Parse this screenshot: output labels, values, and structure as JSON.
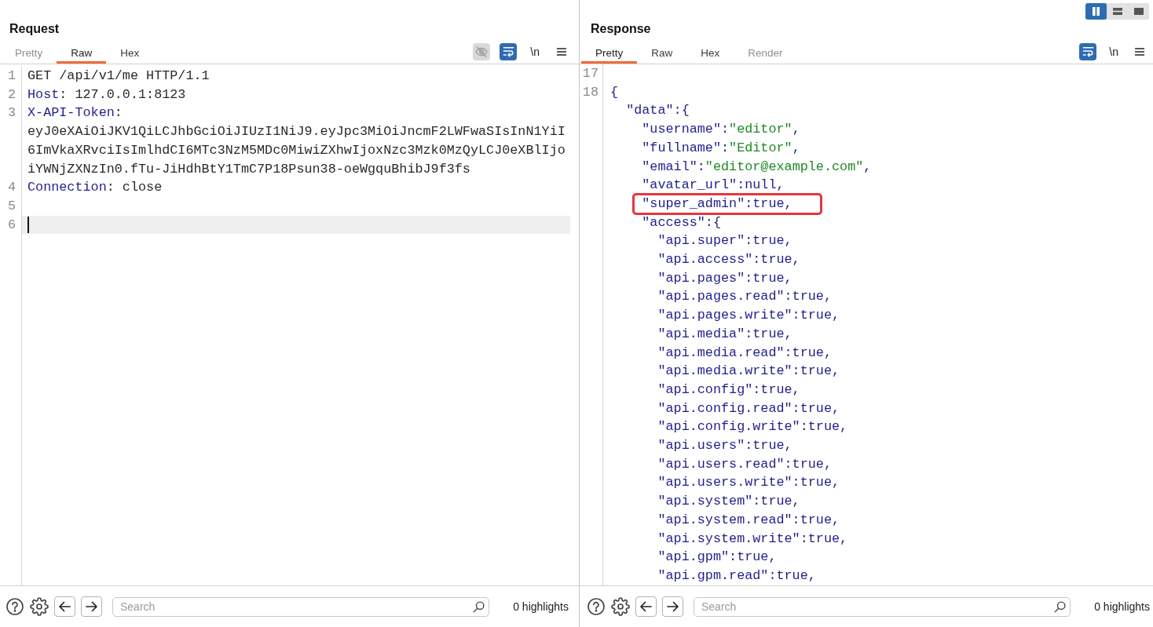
{
  "layout_buttons": [
    {
      "kind": "columns",
      "selected": true
    },
    {
      "kind": "rows",
      "selected": false
    },
    {
      "kind": "single",
      "selected": false
    }
  ],
  "request": {
    "title": "Request",
    "tabs": [
      {
        "label": "Pretty",
        "selected": false,
        "disabled": true
      },
      {
        "label": "Raw",
        "selected": true,
        "disabled": false
      },
      {
        "label": "Hex",
        "selected": false,
        "disabled": false
      }
    ],
    "toolbar": [
      {
        "kind": "eye",
        "on": false
      },
      {
        "kind": "wrap",
        "on": true
      },
      {
        "kind": "label",
        "label": "\\n"
      },
      {
        "kind": "menu"
      }
    ],
    "lines": [
      {
        "number": "1",
        "current": false,
        "tokens": [
          {
            "kind": "text",
            "text": "GET /api/v1/me HTTP/1.1"
          }
        ]
      },
      {
        "number": "2",
        "current": false,
        "tokens": [
          {
            "kind": "header",
            "text": "Host"
          },
          {
            "kind": "text",
            "text": ": 127.0.0.1:8123"
          }
        ]
      },
      {
        "number": "3",
        "current": false,
        "tokens": [
          {
            "kind": "header",
            "text": "X-API-Token"
          },
          {
            "kind": "text",
            "text": ": eyJ0eXAiOiJKV1QiLCJhbGciOiJIUzI1NiJ9.eyJpc3MiOiJncmF2LWFwaSIsInN1YiI6ImVkaXRvciIsImlhdCI6MTc3NzM5MDc0MiwiZXhwIjoxNzc3Mzk0MzQyLCJ0eXBlIjoiYWNjZXNzIn0.fTu-JiHdhBtY1TmC7P18Psun38-oeWgquBhibJ9f3fs"
          }
        ]
      },
      {
        "number": "4",
        "current": false,
        "tokens": [
          {
            "kind": "header",
            "text": "Connection"
          },
          {
            "kind": "text",
            "text": ": close"
          }
        ]
      },
      {
        "number": "5",
        "current": false
      },
      {
        "number": "6",
        "current": true
      }
    ],
    "footer": {
      "search": {
        "placeholder": "Search"
      },
      "highlights": "0 highlights"
    }
  },
  "response": {
    "title": "Response",
    "tabs": [
      {
        "label": "Pretty",
        "selected": true,
        "disabled": false
      },
      {
        "label": "Raw",
        "selected": false,
        "disabled": false
      },
      {
        "label": "Hex",
        "selected": false,
        "disabled": false
      },
      {
        "label": "Render",
        "selected": false,
        "disabled": true
      }
    ],
    "toolbar": [
      {
        "kind": "wrap",
        "on": true
      },
      {
        "kind": "label",
        "label": "\\n"
      },
      {
        "kind": "menu"
      }
    ],
    "lines": [
      {
        "number": "17"
      },
      {
        "number": "18",
        "tokens": [
          {
            "kind": "syntax",
            "text": "{"
          }
        ],
        "children": [
          {
            "tokens": [
              {
                "kind": "syntax",
                "text": "\"data\":{"
              }
            ],
            "children": [
              {
                "highlighted": false,
                "tokens": [
                  {
                    "kind": "syntax",
                    "text": "\"username\":"
                  },
                  {
                    "kind": "string",
                    "text": "\"editor\""
                  },
                  {
                    "kind": "syntax",
                    "text": ","
                  }
                ]
              },
              {
                "highlighted": false,
                "tokens": [
                  {
                    "kind": "syntax",
                    "text": "\"fullname\":"
                  },
                  {
                    "kind": "string",
                    "text": "\"Editor\""
                  },
                  {
                    "kind": "syntax",
                    "text": ","
                  }
                ]
              },
              {
                "highlighted": false,
                "tokens": [
                  {
                    "kind": "syntax",
                    "text": "\"email\":"
                  },
                  {
                    "kind": "string",
                    "text": "\"editor@example.com\""
                  },
                  {
                    "kind": "syntax",
                    "text": ","
                  }
                ]
              },
              {
                "highlighted": false,
                "tokens": [
                  {
                    "kind": "syntax",
                    "text": "\"avatar_url\":null,"
                  }
                ]
              },
              {
                "highlighted": true,
                "tokens": [
                  {
                    "kind": "syntax",
                    "text": "\"super_admin\":true,"
                  }
                ]
              },
              {
                "highlighted": false,
                "tokens": [
                  {
                    "kind": "syntax",
                    "text": "\"access\":{"
                  }
                ],
                "children": [
                  {
                    "tokens": [
                      {
                        "kind": "syntax",
                        "text": "\"api.super\":true,"
                      }
                    ]
                  },
                  {
                    "tokens": [
                      {
                        "kind": "syntax",
                        "text": "\"api.access\":true,"
                      }
                    ]
                  },
                  {
                    "tokens": [
                      {
                        "kind": "syntax",
                        "text": "\"api.pages\":true,"
                      }
                    ]
                  },
                  {
                    "tokens": [
                      {
                        "kind": "syntax",
                        "text": "\"api.pages.read\":true,"
                      }
                    ]
                  },
                  {
                    "tokens": [
                      {
                        "kind": "syntax",
                        "text": "\"api.pages.write\":true,"
                      }
                    ]
                  },
                  {
                    "tokens": [
                      {
                        "kind": "syntax",
                        "text": "\"api.media\":true,"
                      }
                    ]
                  },
                  {
                    "tokens": [
                      {
                        "kind": "syntax",
                        "text": "\"api.media.read\":true,"
                      }
                    ]
                  },
                  {
                    "tokens": [
                      {
                        "kind": "syntax",
                        "text": "\"api.media.write\":true,"
                      }
                    ]
                  },
                  {
                    "tokens": [
                      {
                        "kind": "syntax",
                        "text": "\"api.config\":true,"
                      }
                    ]
                  },
                  {
                    "tokens": [
                      {
                        "kind": "syntax",
                        "text": "\"api.config.read\":true,"
                      }
                    ]
                  },
                  {
                    "tokens": [
                      {
                        "kind": "syntax",
                        "text": "\"api.config.write\":true,"
                      }
                    ]
                  },
                  {
                    "tokens": [
                      {
                        "kind": "syntax",
                        "text": "\"api.users\":true,"
                      }
                    ]
                  },
                  {
                    "tokens": [
                      {
                        "kind": "syntax",
                        "text": "\"api.users.read\":true,"
                      }
                    ]
                  },
                  {
                    "tokens": [
                      {
                        "kind": "syntax",
                        "text": "\"api.users.write\":true,"
                      }
                    ]
                  },
                  {
                    "tokens": [
                      {
                        "kind": "syntax",
                        "text": "\"api.system\":true,"
                      }
                    ]
                  },
                  {
                    "tokens": [
                      {
                        "kind": "syntax",
                        "text": "\"api.system.read\":true,"
                      }
                    ]
                  },
                  {
                    "tokens": [
                      {
                        "kind": "syntax",
                        "text": "\"api.system.write\":true,"
                      }
                    ]
                  },
                  {
                    "tokens": [
                      {
                        "kind": "syntax",
                        "text": "\"api.gpm\":true,"
                      }
                    ]
                  },
                  {
                    "tokens": [
                      {
                        "kind": "syntax",
                        "text": "\"api.gpm.read\":true,"
                      }
                    ]
                  }
                ]
              }
            ]
          }
        ]
      }
    ],
    "footer": {
      "search": {
        "placeholder": "Search"
      },
      "highlights": "0 highlights"
    }
  }
}
